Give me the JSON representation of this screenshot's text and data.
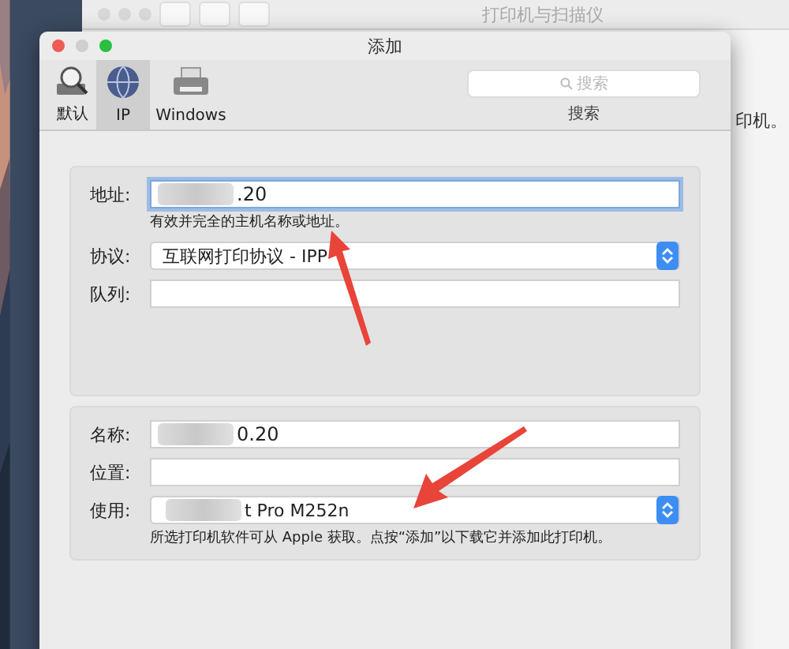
{
  "back_window": {
    "title": "打印机与扫描仪",
    "side_text": "印机。"
  },
  "dialog": {
    "title": "添加",
    "toolbar": [
      {
        "kind": "default",
        "label": "默认",
        "selected": false
      },
      {
        "kind": "ip",
        "label": "IP",
        "selected": true
      },
      {
        "kind": "windows",
        "label": "Windows",
        "selected": false
      }
    ],
    "search": {
      "placeholder": "搜索",
      "label": "搜索"
    },
    "top_group": [
      {
        "kind": "text",
        "label": "地址:",
        "value": ".20",
        "blurred": true,
        "focused": true,
        "hint": "有效并完全的主机名称或地址。"
      },
      {
        "kind": "select",
        "label": "协议:",
        "value": "互联网打印协议 - IPP",
        "blurred": false
      },
      {
        "kind": "text",
        "label": "队列:",
        "blurred": false,
        "focused": false
      }
    ],
    "bottom_group": [
      {
        "kind": "text",
        "label": "名称:",
        "value": "0.20",
        "blurred": true,
        "focused": false
      },
      {
        "kind": "text",
        "label": "位置:",
        "blurred": false,
        "focused": false
      },
      {
        "kind": "select",
        "label": "使用:",
        "value": "t Pro M252n",
        "blurred": true,
        "hint": "所选打印机软件可从 Apple 获取。点按“添加”以下载它并添加此打印机。"
      }
    ]
  }
}
